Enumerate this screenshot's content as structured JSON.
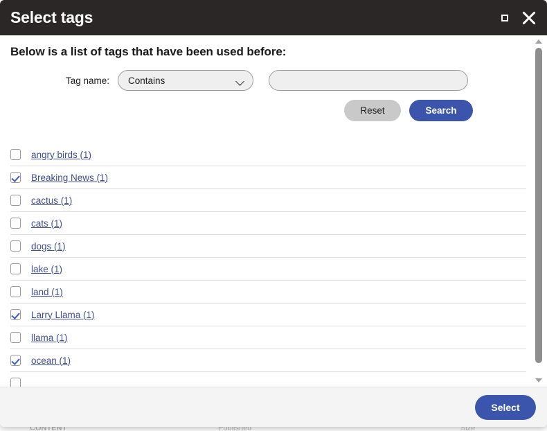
{
  "window": {
    "title": "Select tags",
    "maximize_icon": "maximize-icon",
    "close_icon": "close-icon"
  },
  "content": {
    "heading": "Below is a list of tags that have been used before:"
  },
  "search": {
    "label": "Tag name:",
    "operator_selected": "Contains",
    "operator_options": [
      "Contains"
    ],
    "input_value": "",
    "input_placeholder": "",
    "reset_label": "Reset",
    "search_label": "Search"
  },
  "tags": [
    {
      "label": "angry birds (1)",
      "checked": false
    },
    {
      "label": "Breaking News (1)",
      "checked": true
    },
    {
      "label": "cactus (1)",
      "checked": false
    },
    {
      "label": "cats (1)",
      "checked": false
    },
    {
      "label": "dogs (1)",
      "checked": false
    },
    {
      "label": "lake (1)",
      "checked": false
    },
    {
      "label": "land (1)",
      "checked": false
    },
    {
      "label": "Larry Llama (1)",
      "checked": true
    },
    {
      "label": "llama (1)",
      "checked": false
    },
    {
      "label": "ocean (1)",
      "checked": true
    },
    {
      "label": "",
      "checked": false
    }
  ],
  "footer": {
    "select_label": "Select"
  },
  "background": {
    "footer_col1": "CONTENT",
    "footer_col2": "Published",
    "footer_col3": "Size"
  },
  "colors": {
    "titlebar": "#2b2726",
    "primary": "#3b55ac",
    "link": "#414f8e",
    "reset": "#c9c9c9"
  }
}
